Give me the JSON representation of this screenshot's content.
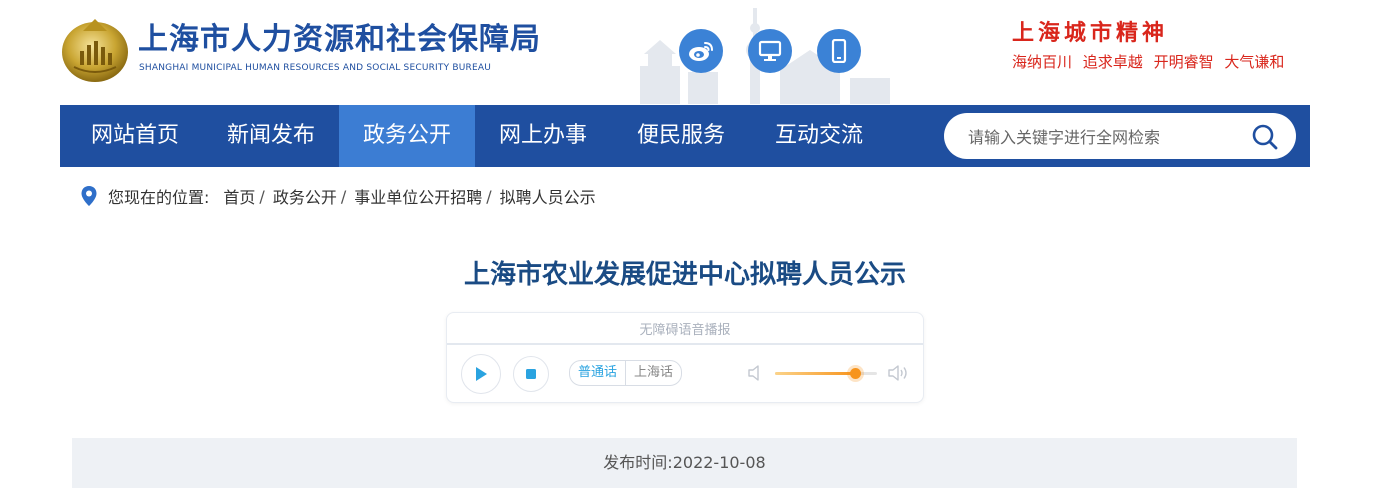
{
  "header": {
    "org_name_cn": "上海市人力资源和社会保障局",
    "org_name_en": "SHANGHAI MUNICIPAL HUMAN RESOURCES AND SOCIAL SECURITY BUREAU",
    "social_icons": [
      "weibo-icon",
      "desktop-icon",
      "mobile-icon"
    ],
    "city_spirit_title": "上海城市精神",
    "city_spirit_words": [
      "海纳百川",
      "追求卓越",
      "开明睿智",
      "大气谦和"
    ]
  },
  "nav": {
    "items": [
      {
        "label": "网站首页"
      },
      {
        "label": "新闻发布"
      },
      {
        "label": "政务公开",
        "active": true
      },
      {
        "label": "网上办事"
      },
      {
        "label": "便民服务"
      },
      {
        "label": "互动交流"
      }
    ],
    "search_placeholder": "请输入关键字进行全网检索"
  },
  "breadcrumb": {
    "prefix": "您现在的位置:",
    "items": [
      "首页",
      "政务公开",
      "事业单位公开招聘",
      "拟聘人员公示"
    ]
  },
  "article": {
    "title": "上海市农业发展促进中心拟聘人员公示",
    "publish_label": "发布时间:",
    "publish_date": "2022-10-08"
  },
  "audio_player": {
    "label": "无障碍语音播报",
    "languages": [
      "普通话",
      "上海话"
    ],
    "selected_language": "普通话",
    "volume": 0.78
  },
  "colors": {
    "nav_bg": "#1f4fa0",
    "nav_active": "#3c7dd3",
    "title": "#1a4b84",
    "spirit_red": "#d9261c",
    "accent_orange": "#f7941d"
  }
}
